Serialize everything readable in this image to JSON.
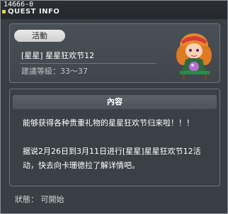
{
  "header": {
    "quest_id": "14666-0",
    "title": "QUEST INFO"
  },
  "summary": {
    "category": "活動",
    "quest_name": "[星星] 星星狂欢节12",
    "level_requirement": "建議等級：33～37"
  },
  "content": {
    "header": "內容",
    "paragraph1": "能够获得各种贵重礼物的星星狂欢节归来啦！！！",
    "paragraph2": "据说2月26日到3月11日进行[星星]星星狂欢节12活动，快去向卡珊德拉了解详情吧。"
  },
  "footer": {
    "status": "狀態： 可開始"
  },
  "colors": {
    "window_bg": "#3a3f45",
    "accent_title": "#f0d24a"
  },
  "icons": {
    "npc": "npc-portrait-icon"
  }
}
